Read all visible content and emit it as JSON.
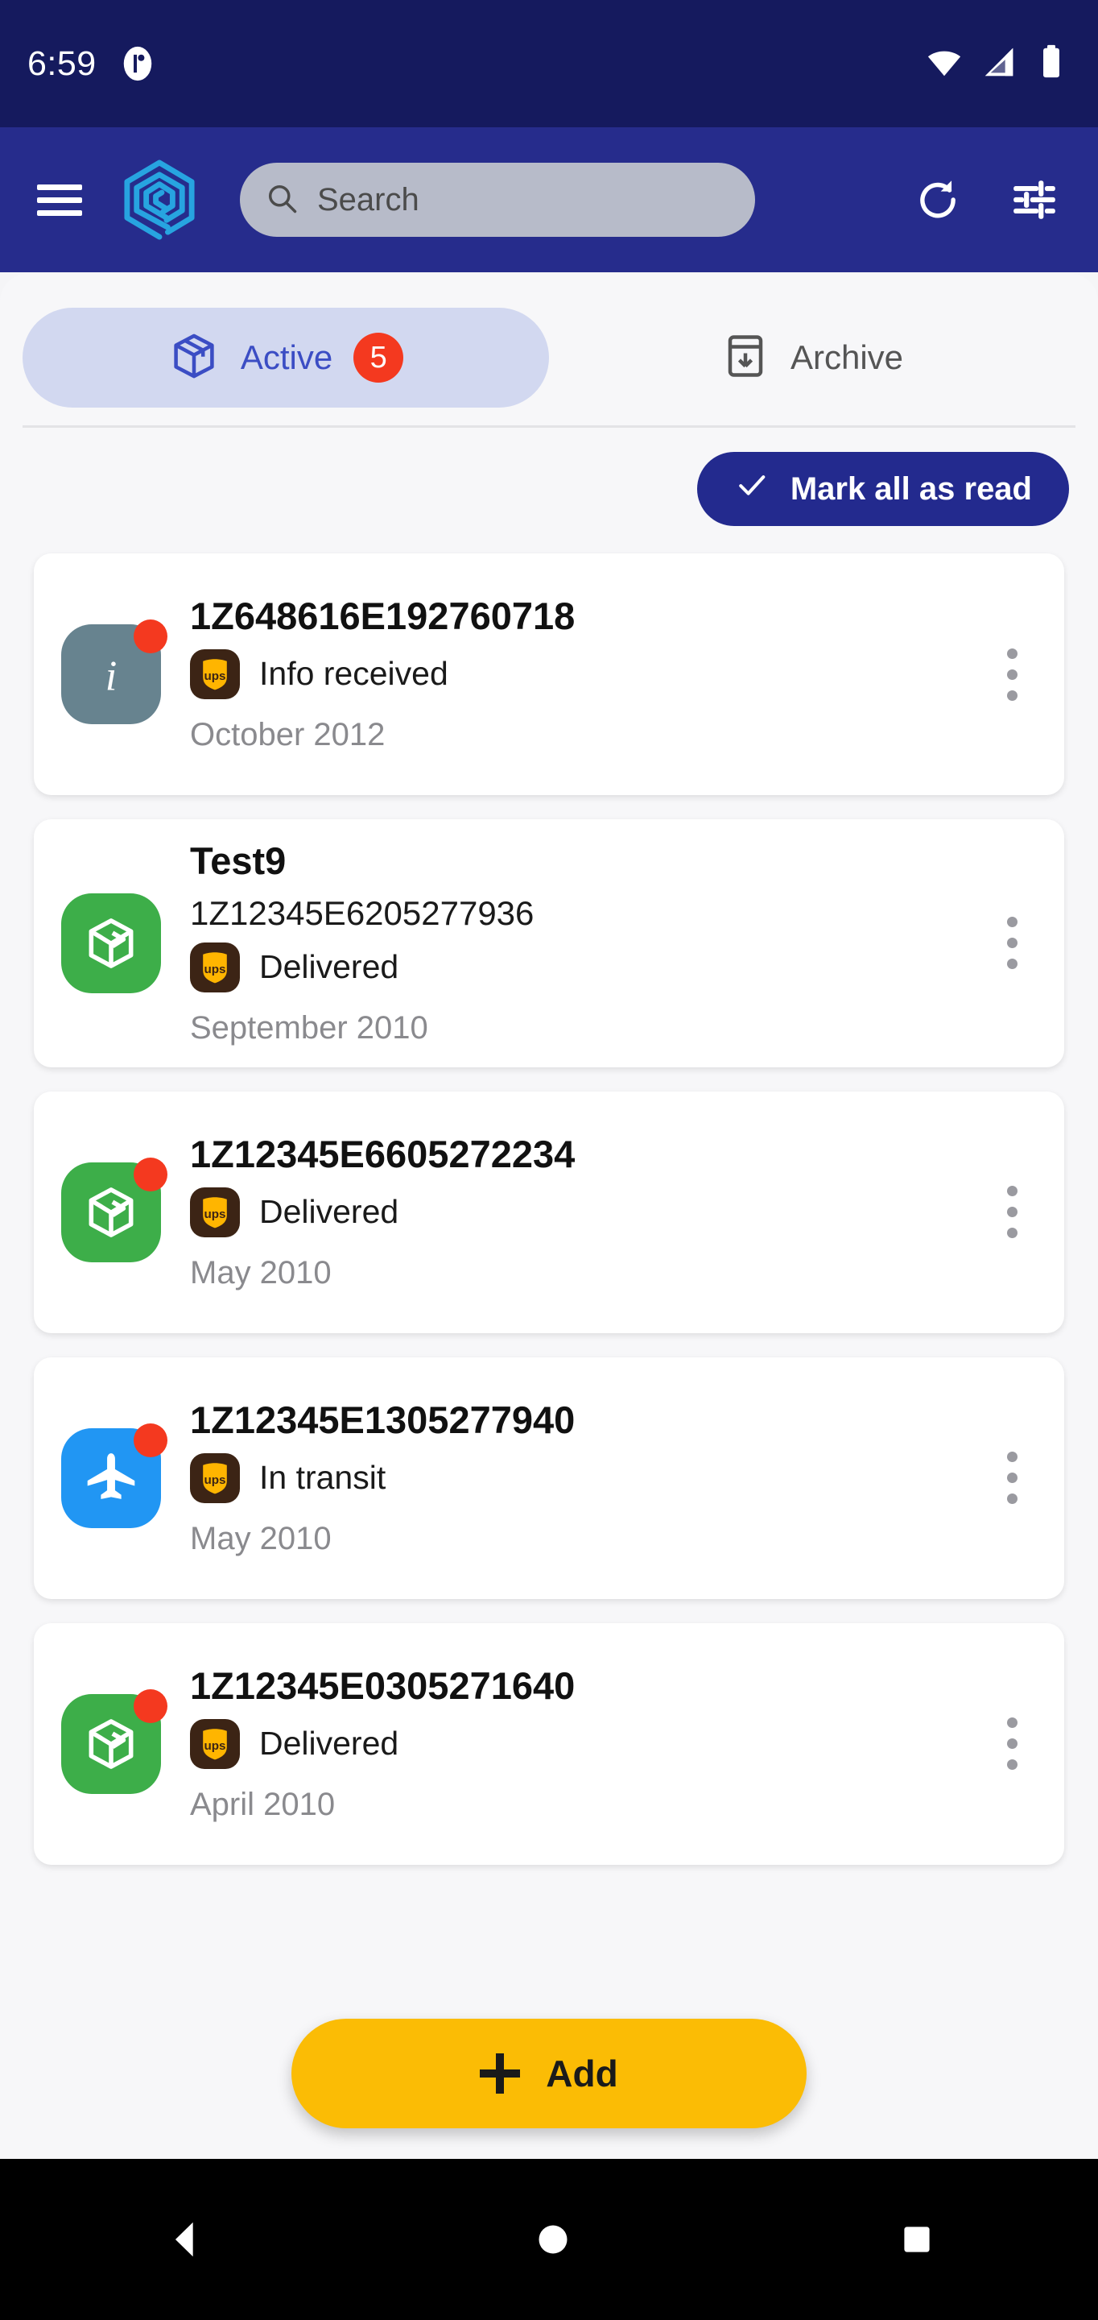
{
  "status_bar": {
    "time": "6:59",
    "left_icon": "app-notification-icon",
    "icons": [
      "wifi-icon",
      "cellular-signal-icon",
      "battery-icon"
    ]
  },
  "app_bar": {
    "menu_icon": "hamburger-menu-icon",
    "logo_icon": "app-logo-spiral-hexagon-icon",
    "search": {
      "icon": "search-icon",
      "placeholder": "Search",
      "value": ""
    },
    "refresh_icon": "refresh-icon",
    "filter_icon": "tune-filter-icon"
  },
  "tabs": [
    {
      "label": "Active",
      "icon": "package-box-icon",
      "badge": "5",
      "selected": true
    },
    {
      "label": "Archive",
      "icon": "archive-box-icon",
      "badge": "",
      "selected": false
    }
  ],
  "toolbar": {
    "mark_all_label": "Mark all as read",
    "mark_all_icon": "check-icon"
  },
  "shipments": [
    {
      "title": "",
      "tracking": "1Z648616E192760718",
      "status": "Info received",
      "date": "October 2012",
      "carrier": "ups-logo-icon",
      "avatar_icon": "info-icon",
      "avatar_color": "#67838F",
      "unread": true
    },
    {
      "title": "Test9",
      "tracking": "1Z12345E6205277936",
      "status": "Delivered",
      "date": "September 2010",
      "carrier": "ups-logo-icon",
      "avatar_icon": "delivered-box-icon",
      "avatar_color": "#3DAE49",
      "unread": false
    },
    {
      "title": "",
      "tracking": "1Z12345E6605272234",
      "status": "Delivered",
      "date": "May 2010",
      "carrier": "ups-logo-icon",
      "avatar_icon": "delivered-box-icon",
      "avatar_color": "#3DAE49",
      "unread": true
    },
    {
      "title": "",
      "tracking": "1Z12345E1305277940",
      "status": "In transit",
      "date": "May 2010",
      "carrier": "ups-logo-icon",
      "avatar_icon": "airplane-icon",
      "avatar_color": "#2196F3",
      "unread": true
    },
    {
      "title": "",
      "tracking": "1Z12345E0305271640",
      "status": "Delivered",
      "date": "April 2010",
      "carrier": "ups-logo-icon",
      "avatar_icon": "delivered-box-icon",
      "avatar_color": "#3DAE49",
      "unread": true
    }
  ],
  "fab": {
    "label": "Add",
    "icon": "plus-icon"
  },
  "nav_bar": {
    "back": "back-triangle-icon",
    "home": "home-circle-icon",
    "recents": "recents-square-icon"
  },
  "colors": {
    "status_bar_bg": "#151A5E",
    "app_bar_bg": "#262C8C",
    "accent_blue": "#3B4DC4",
    "badge_red": "#F4391F",
    "fab_yellow": "#FBBC05",
    "delivered_green": "#3DAE49",
    "transit_blue": "#2196F3",
    "info_slate": "#67838F",
    "ups_brown": "#3C2415",
    "ups_gold": "#FFB500",
    "tab_active_bg": "#D2D8F0"
  }
}
